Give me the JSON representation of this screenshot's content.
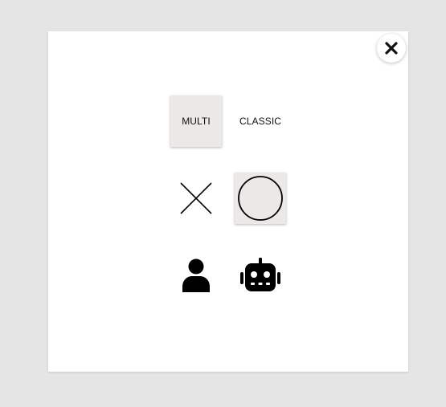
{
  "modal": {
    "close_icon": "close-icon"
  },
  "mode": {
    "options": [
      {
        "label": "MULTI",
        "selected": true
      },
      {
        "label": "CLASSIC",
        "selected": false
      }
    ]
  },
  "mark": {
    "options": [
      {
        "icon": "x-mark-icon",
        "selected": false
      },
      {
        "icon": "o-mark-icon",
        "selected": true
      }
    ]
  },
  "opponent": {
    "options": [
      {
        "icon": "person-icon",
        "selected": false
      },
      {
        "icon": "robot-icon",
        "selected": false
      }
    ]
  },
  "colors": {
    "overlay": "#e5e5e5",
    "panel": "#ffffff",
    "selected_bg": "#ede8e8",
    "icon": "#000000"
  }
}
